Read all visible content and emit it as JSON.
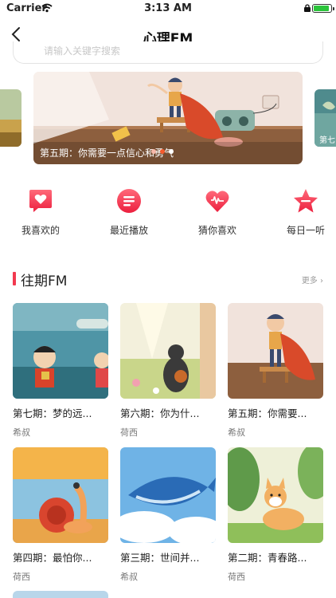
{
  "status": {
    "carrier": "Carrier",
    "time": "3:13 AM"
  },
  "nav": {
    "title": "心理FM"
  },
  "search": {
    "placeholder": "请输入关键字搜索"
  },
  "banner": {
    "caption": "第五期：你需要一点信心和勇气",
    "right_peek": "第七",
    "dots": 3,
    "active_dot": 1
  },
  "quick_menu": [
    {
      "label": "我喜欢的",
      "icon": "heart-chat-icon"
    },
    {
      "label": "最近播放",
      "icon": "playlist-icon"
    },
    {
      "label": "猜你喜欢",
      "icon": "heart-wave-icon"
    },
    {
      "label": "每日一听",
      "icon": "star-icon"
    }
  ],
  "section": {
    "title": "往期FM",
    "more": "更多"
  },
  "episodes": [
    {
      "title": "第七期：梦的远...",
      "author": "希叔"
    },
    {
      "title": "第六期：你为什...",
      "author": "荷西"
    },
    {
      "title": "第五期：你需要...",
      "author": "希叔"
    },
    {
      "title": "第四期：最怕你...",
      "author": "荷西"
    },
    {
      "title": "第三期：世间并...",
      "author": "希叔"
    },
    {
      "title": "第二期：青春路...",
      "author": "荷西"
    }
  ],
  "colors": {
    "accent": "#f2394f",
    "battery": "#2bc43b"
  }
}
